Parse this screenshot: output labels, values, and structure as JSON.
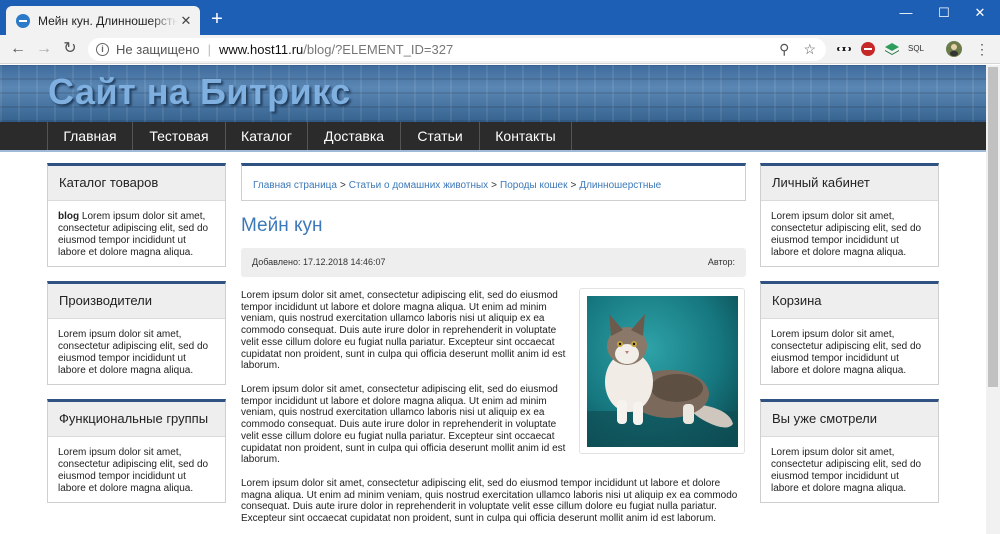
{
  "browser": {
    "tab_title": "Мейн кун. Длинношерстные. Ст",
    "tab_close": "✕",
    "new_tab": "+",
    "security": "Не защищено",
    "url_host": "www.host11.ru",
    "url_path": "/blog/?ELEMENT_ID=327",
    "ext_sql": "SQL"
  },
  "site": {
    "title": "Сайт на Битрикс",
    "menu": [
      "Главная",
      "Тестовая",
      "Каталог",
      "Доставка",
      "Статьи",
      "Контакты"
    ]
  },
  "left_boxes": [
    {
      "title": "Каталог товаров",
      "bold": "blog",
      "text": " Lorem ipsum dolor sit amet, consectetur adipiscing elit, sed do eiusmod tempor incididunt ut labore et dolore magna aliqua."
    },
    {
      "title": "Производители",
      "bold": "",
      "text": "Lorem ipsum dolor sit amet, consectetur adipiscing elit, sed do eiusmod tempor incididunt ut labore et dolore magna aliqua."
    },
    {
      "title": "Функциональные группы",
      "bold": "",
      "text": "Lorem ipsum dolor sit amet, consectetur adipiscing elit, sed do eiusmod tempor incididunt ut labore et dolore magna aliqua."
    }
  ],
  "right_boxes": [
    {
      "title": "Личный кабинет",
      "text": "Lorem ipsum dolor sit amet, consectetur adipiscing elit, sed do eiusmod tempor incididunt ut labore et dolore magna aliqua."
    },
    {
      "title": "Корзина",
      "text": "Lorem ipsum dolor sit amet, consectetur adipiscing elit, sed do eiusmod tempor incididunt ut labore et dolore magna aliqua."
    },
    {
      "title": "Вы уже смотрели",
      "text": "Lorem ipsum dolor sit amet, consectetur adipiscing elit, sed do eiusmod tempor incididunt ut labore et dolore magna aliqua."
    }
  ],
  "breadcrumbs": [
    "Главная страница",
    "Статьи о домашних животных",
    "Породы кошек",
    "Длинношерстные"
  ],
  "breadcrumb_sep": ">",
  "article": {
    "title": "Мейн кун",
    "date_label": "Добавлено: 17.12.2018 14:46:07",
    "author_label": "Автор:",
    "paragraphs": [
      "Lorem ipsum dolor sit amet, consectetur adipiscing elit, sed do eiusmod tempor incididunt ut labore et dolore magna aliqua. Ut enim ad minim veniam, quis nostrud exercitation ullamco laboris nisi ut aliquip ex ea commodo consequat. Duis aute irure dolor in reprehenderit in voluptate velit esse cillum dolore eu fugiat nulla pariatur. Excepteur sint occaecat cupidatat non proident, sunt in culpa qui officia deserunt mollit anim id est laborum.",
      "Lorem ipsum dolor sit amet, consectetur adipiscing elit, sed do eiusmod tempor incididunt ut labore et dolore magna aliqua. Ut enim ad minim veniam, quis nostrud exercitation ullamco laboris nisi ut aliquip ex ea commodo consequat. Duis aute irure dolor in reprehenderit in voluptate velit esse cillum dolore eu fugiat nulla pariatur. Excepteur sint occaecat cupidatat non proident, sunt in culpa qui officia deserunt mollit anim id est laborum.",
      "Lorem ipsum dolor sit amet, consectetur adipiscing elit, sed do eiusmod tempor incididunt ut labore et dolore magna aliqua. Ut enim ad minim veniam, quis nostrud exercitation ullamco laboris nisi ut aliquip ex ea commodo consequat. Duis aute irure dolor in reprehenderit in voluptate velit esse cillum dolore eu fugiat nulla pariatur. Excepteur sint occaecat cupidatat non proident, sunt in culpa qui officia deserunt mollit anim id est laborum."
    ]
  },
  "colors": {
    "chrome_blue": "#1d5fb4",
    "link_blue": "#3d79b8",
    "box_accent": "#2f5282",
    "menu_bg": "#2b2b2b"
  }
}
